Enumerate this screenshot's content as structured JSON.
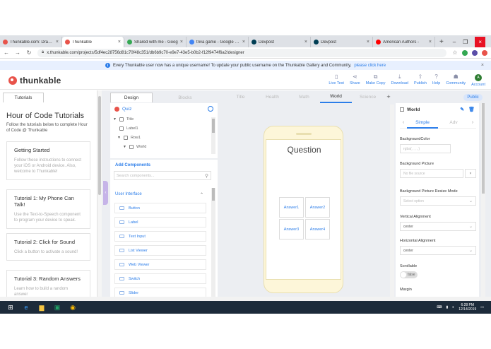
{
  "browser": {
    "tabs": [
      {
        "title": "Thunkable.com: Drag a",
        "color": "#e8534a"
      },
      {
        "title": "Thunkable",
        "color": "#e8534a"
      },
      {
        "title": "Shared with me - Goog",
        "color": "#34a853"
      },
      {
        "title": "triva game - Google Do",
        "color": "#4285f4"
      },
      {
        "title": "Devpost",
        "color": "#003e54"
      },
      {
        "title": "Devpost",
        "color": "#003e54"
      },
      {
        "title": "American Authors - ",
        "color": "#ff0000"
      }
    ],
    "url": "x.thunkable.com/projects/5df4ec28756d81c70f48c351/db6b9c70-e9e7-43e5-b0b2-f12f9474f6a2/designer"
  },
  "banner": {
    "text": "Every Thunkable user now has a unique username! To update your public username on the Thunkable Gallery and Community,",
    "link": "please click here"
  },
  "header": {
    "logo_text": "thunkable",
    "actions": [
      {
        "label": "Live Test",
        "icon": "phone-icon",
        "glyph": "▯"
      },
      {
        "label": "Share",
        "icon": "share-icon",
        "glyph": "⋖"
      },
      {
        "label": "Make Copy",
        "icon": "copy-icon",
        "glyph": "⧉"
      },
      {
        "label": "Download",
        "icon": "download-icon",
        "glyph": "⤓"
      },
      {
        "label": "Publish",
        "icon": "publish-icon",
        "glyph": "⇧"
      },
      {
        "label": "Help",
        "icon": "help-icon",
        "glyph": "?"
      },
      {
        "label": "Community",
        "icon": "community-icon",
        "glyph": "☗"
      },
      {
        "label": "Account",
        "icon": "account-icon",
        "glyph": "A"
      }
    ]
  },
  "tutorials": {
    "tab": "Tutorials",
    "title": "Hour of Code Tutorials",
    "description": "Follow the tutorials below to complete Hour of Code @ Thunkable",
    "cards": [
      {
        "title": "Getting Started",
        "desc": "Follow these instructions to connect your iOS or Android device. Also, welcome to Thunkable!"
      },
      {
        "title": "Tutorial 1: My Phone Can Talk!",
        "desc": "Use the Text-to-Speech component to program your device to speak."
      },
      {
        "title": "Tutorial 2: Click for Sound",
        "desc": "Click a button to activate a sound!"
      },
      {
        "title": "Tutorial 3: Random Answers",
        "desc": "Learn how to build a random answer"
      }
    ]
  },
  "editor_tabs": {
    "design": "Design",
    "blocks": "Blocks"
  },
  "tree": {
    "project": "Quiz",
    "items": [
      "Title",
      "Label1",
      "Row1",
      "World"
    ]
  },
  "palette": {
    "add_label": "Add Components",
    "search_placeholder": "Search components...",
    "section": "User Interface",
    "components": [
      "Button",
      "Label",
      "Text Input",
      "List Viewer",
      "Web Viewer",
      "Switch",
      "Slider"
    ]
  },
  "screens": {
    "tabs": [
      "Title",
      "Health",
      "Math",
      "World",
      "Science"
    ],
    "active": "World",
    "public_label": "Public"
  },
  "preview": {
    "question": "Question",
    "answers": [
      "Answer1",
      "Answer2",
      "Answer3",
      "Answer4"
    ]
  },
  "properties": {
    "component": "World",
    "tabs": [
      "Simple",
      "Adv"
    ],
    "fields": [
      {
        "label": "BackgroundColor",
        "value": "rgba( , , , )"
      },
      {
        "label": "Background Picture",
        "value": "No file source"
      },
      {
        "label": "Background Picture Resize Mode",
        "value": "Select option"
      },
      {
        "label": "Vertical Alignment",
        "value": "center"
      },
      {
        "label": "Horizontal Alignment",
        "value": "center"
      },
      {
        "label": "Scrollable",
        "value": "false"
      },
      {
        "label": "Margin",
        "value": ""
      }
    ]
  },
  "taskbar": {
    "time": "6:28 PM",
    "date": "12/14/2019"
  }
}
